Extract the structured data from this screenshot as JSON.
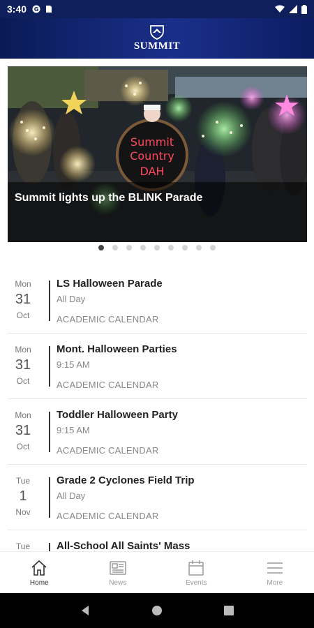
{
  "status_bar": {
    "time": "3:40",
    "icons": [
      "notification-icon",
      "sim-icon",
      "wifi-icon",
      "signal-icon",
      "battery-icon"
    ]
  },
  "header": {
    "brand": "SUMMIT",
    "logo_icon": "shield-logo-icon"
  },
  "hero": {
    "title": "Summit lights up the BLINK Parade",
    "sign_text_1": "Summit",
    "sign_text_2": "Country",
    "sign_text_3": "DAH",
    "slide_count": 9,
    "active_slide": 0
  },
  "events": [
    {
      "dow": "Mon",
      "day": "31",
      "month": "Oct",
      "title": "LS Halloween Parade",
      "time": "All Day",
      "calendar": "ACADEMIC CALENDAR"
    },
    {
      "dow": "Mon",
      "day": "31",
      "month": "Oct",
      "title": "Mont. Halloween Parties",
      "time": "9:15 AM",
      "calendar": "ACADEMIC CALENDAR"
    },
    {
      "dow": "Mon",
      "day": "31",
      "month": "Oct",
      "title": "Toddler Halloween Party",
      "time": "9:15 AM",
      "calendar": "ACADEMIC CALENDAR"
    },
    {
      "dow": "Tue",
      "day": "1",
      "month": "Nov",
      "title": "Grade 2 Cyclones Field Trip",
      "time": "All Day",
      "calendar": "ACADEMIC CALENDAR"
    },
    {
      "dow": "Tue",
      "day": "",
      "month": "",
      "title": "All-School All Saints' Mass",
      "time": "",
      "calendar": ""
    }
  ],
  "bottom_nav": [
    {
      "label": "Home",
      "icon": "home-icon",
      "active": true
    },
    {
      "label": "News",
      "icon": "news-icon",
      "active": false
    },
    {
      "label": "Events",
      "icon": "calendar-icon",
      "active": false
    },
    {
      "label": "More",
      "icon": "menu-icon",
      "active": false
    }
  ],
  "colors": {
    "header_dark": "#0a1a56",
    "header_light": "#1a2f8a",
    "text_primary": "#222222",
    "text_muted": "#888888"
  }
}
